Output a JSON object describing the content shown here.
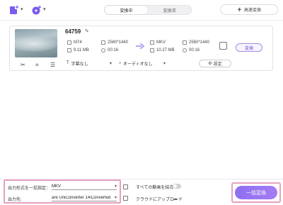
{
  "topbar": {
    "tabs": [
      {
        "label": "変換中",
        "active": true
      },
      {
        "label": "変換済",
        "active": false
      }
    ],
    "high_speed_label": "高速変換"
  },
  "file": {
    "title": "64759",
    "source": {
      "format": "M74",
      "resolution": "2560*1440",
      "size": "9.11 MB",
      "duration": "00:16"
    },
    "target": {
      "format": "MKV",
      "resolution": "2560*1440",
      "size": "10.27 MB",
      "duration": "00:16"
    },
    "convert_label": "変換",
    "subtitle_option": "字幕なし",
    "audio_option": "オーディオなし",
    "settings_label": "設定"
  },
  "bottom": {
    "output_format_label": "出力形式を一括指定：",
    "output_format_value": "MKV",
    "output_path_label": "出力先:",
    "output_path_value": "are UniConverter 14\\Converted",
    "merge_label": "すべての動画を結合",
    "upload_label": "クラウドにアップロード",
    "convert_all_label": "一括変換"
  },
  "colors": {
    "accent": "#9b76f2",
    "highlight": "#e8a0c0"
  }
}
